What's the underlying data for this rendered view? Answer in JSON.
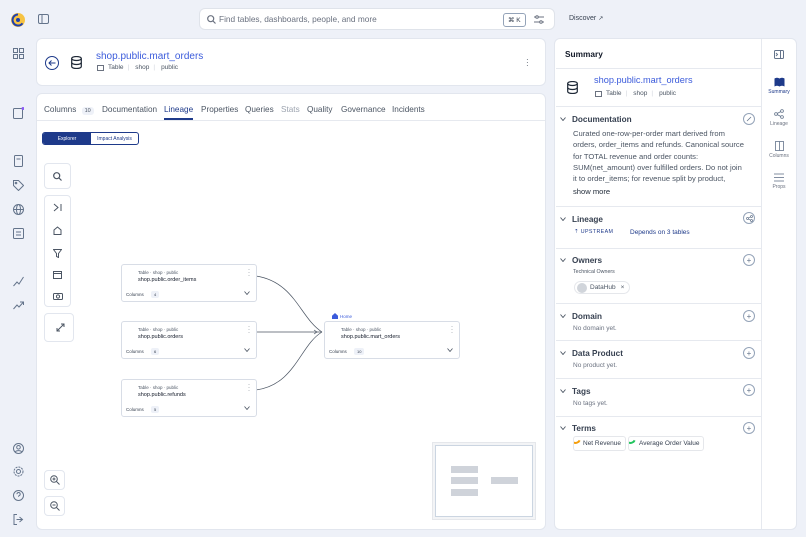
{
  "search": {
    "placeholder": "Find tables, dashboards, people, and more",
    "shortcut": "⌘ K",
    "discover_label": "Discover"
  },
  "header": {
    "title": "shop.public.mart_orders",
    "type": "Table",
    "db": "shop",
    "schema": "public"
  },
  "tabs": {
    "columns": "Columns",
    "columns_count": "10",
    "documentation": "Documentation",
    "lineage": "Lineage",
    "properties": "Properties",
    "queries": "Queries",
    "stats": "Stats",
    "quality": "Quality",
    "governance": "Governance",
    "incidents": "Incidents"
  },
  "lineage": {
    "toggle": {
      "explorer": "Explorer",
      "impact": "Impact Analysis"
    },
    "nodes": [
      {
        "type": "Table",
        "db": "shop",
        "schema": "public",
        "name": "shop.public.order_items",
        "columns_label": "Columns",
        "count": "4"
      },
      {
        "type": "Table",
        "db": "shop",
        "schema": "public",
        "name": "shop.public.orders",
        "columns_label": "Columns",
        "count": "6"
      },
      {
        "type": "Table",
        "db": "shop",
        "schema": "public",
        "name": "shop.public.refunds",
        "columns_label": "Columns",
        "count": "5"
      },
      {
        "type": "Table",
        "db": "shop",
        "schema": "public",
        "name": "shop.public.mart_orders",
        "columns_label": "Columns",
        "count": "10",
        "badge": "Home"
      }
    ]
  },
  "summary": {
    "heading": "Summary",
    "title": "shop.public.mart_orders",
    "type": "Table",
    "db": "shop",
    "schema": "public",
    "documentation": {
      "label": "Documentation",
      "lines": [
        "Curated one-row-per-order mart derived from",
        "orders, order_items and refunds. Canonical source",
        "for TOTAL revenue and order counts:",
        "SUM(net_amount) over fulfilled orders. Do not join",
        "it to order_items; for revenue split by product,"
      ],
      "show_more": "show more"
    },
    "lineage": {
      "label": "Lineage",
      "upstream": "UPSTREAM",
      "depends": "Depends on",
      "count": "3",
      "tables": "tables"
    },
    "owners": {
      "label": "Owners",
      "sub": "Technical Owners",
      "owner": "DataHub"
    },
    "domain": {
      "label": "Domain",
      "empty": "No domain yet."
    },
    "data_product": {
      "label": "Data Product",
      "empty": "No product yet."
    },
    "tags": {
      "label": "Tags",
      "empty": "No tags yet."
    },
    "terms": {
      "label": "Terms",
      "items": [
        "Net Revenue",
        "Average Order Value"
      ]
    }
  },
  "rail": {
    "summary": "Summary",
    "lineage": "Lineage",
    "columns": "Columns",
    "props": "Props"
  }
}
